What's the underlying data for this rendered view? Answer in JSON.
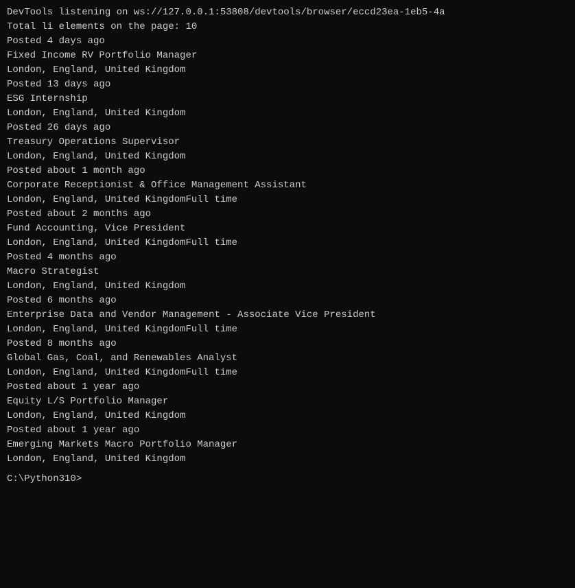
{
  "terminal": {
    "lines": [
      "DevTools listening on ws://127.0.0.1:53808/devtools/browser/eccd23ea-1eb5-4a",
      "Total li elements on the page: 10",
      "Posted 4 days ago",
      "Fixed Income RV Portfolio Manager",
      "London, England, United Kingdom",
      "Posted 13 days ago",
      "ESG Internship",
      "London, England, United Kingdom",
      "Posted 26 days ago",
      "Treasury Operations Supervisor",
      "London, England, United Kingdom",
      "Posted about 1 month ago",
      "Corporate Receptionist & Office Management Assistant",
      "London, England, United KingdomFull time",
      "Posted about 2 months ago",
      "Fund Accounting, Vice President",
      "London, England, United KingdomFull time",
      "Posted 4 months ago",
      "Macro Strategist",
      "London, England, United Kingdom",
      "Posted 6 months ago",
      "Enterprise Data and Vendor Management - Associate Vice President",
      "London, England, United KingdomFull time",
      "Posted 8 months ago",
      "Global Gas, Coal, and Renewables Analyst",
      "London, England, United KingdomFull time",
      "Posted about 1 year ago",
      "Equity L/S Portfolio Manager",
      "London, England, United Kingdom",
      "Posted about 1 year ago",
      "Emerging Markets Macro Portfolio Manager",
      "London, England, United Kingdom"
    ],
    "prompt": "C:\\Python310>"
  }
}
